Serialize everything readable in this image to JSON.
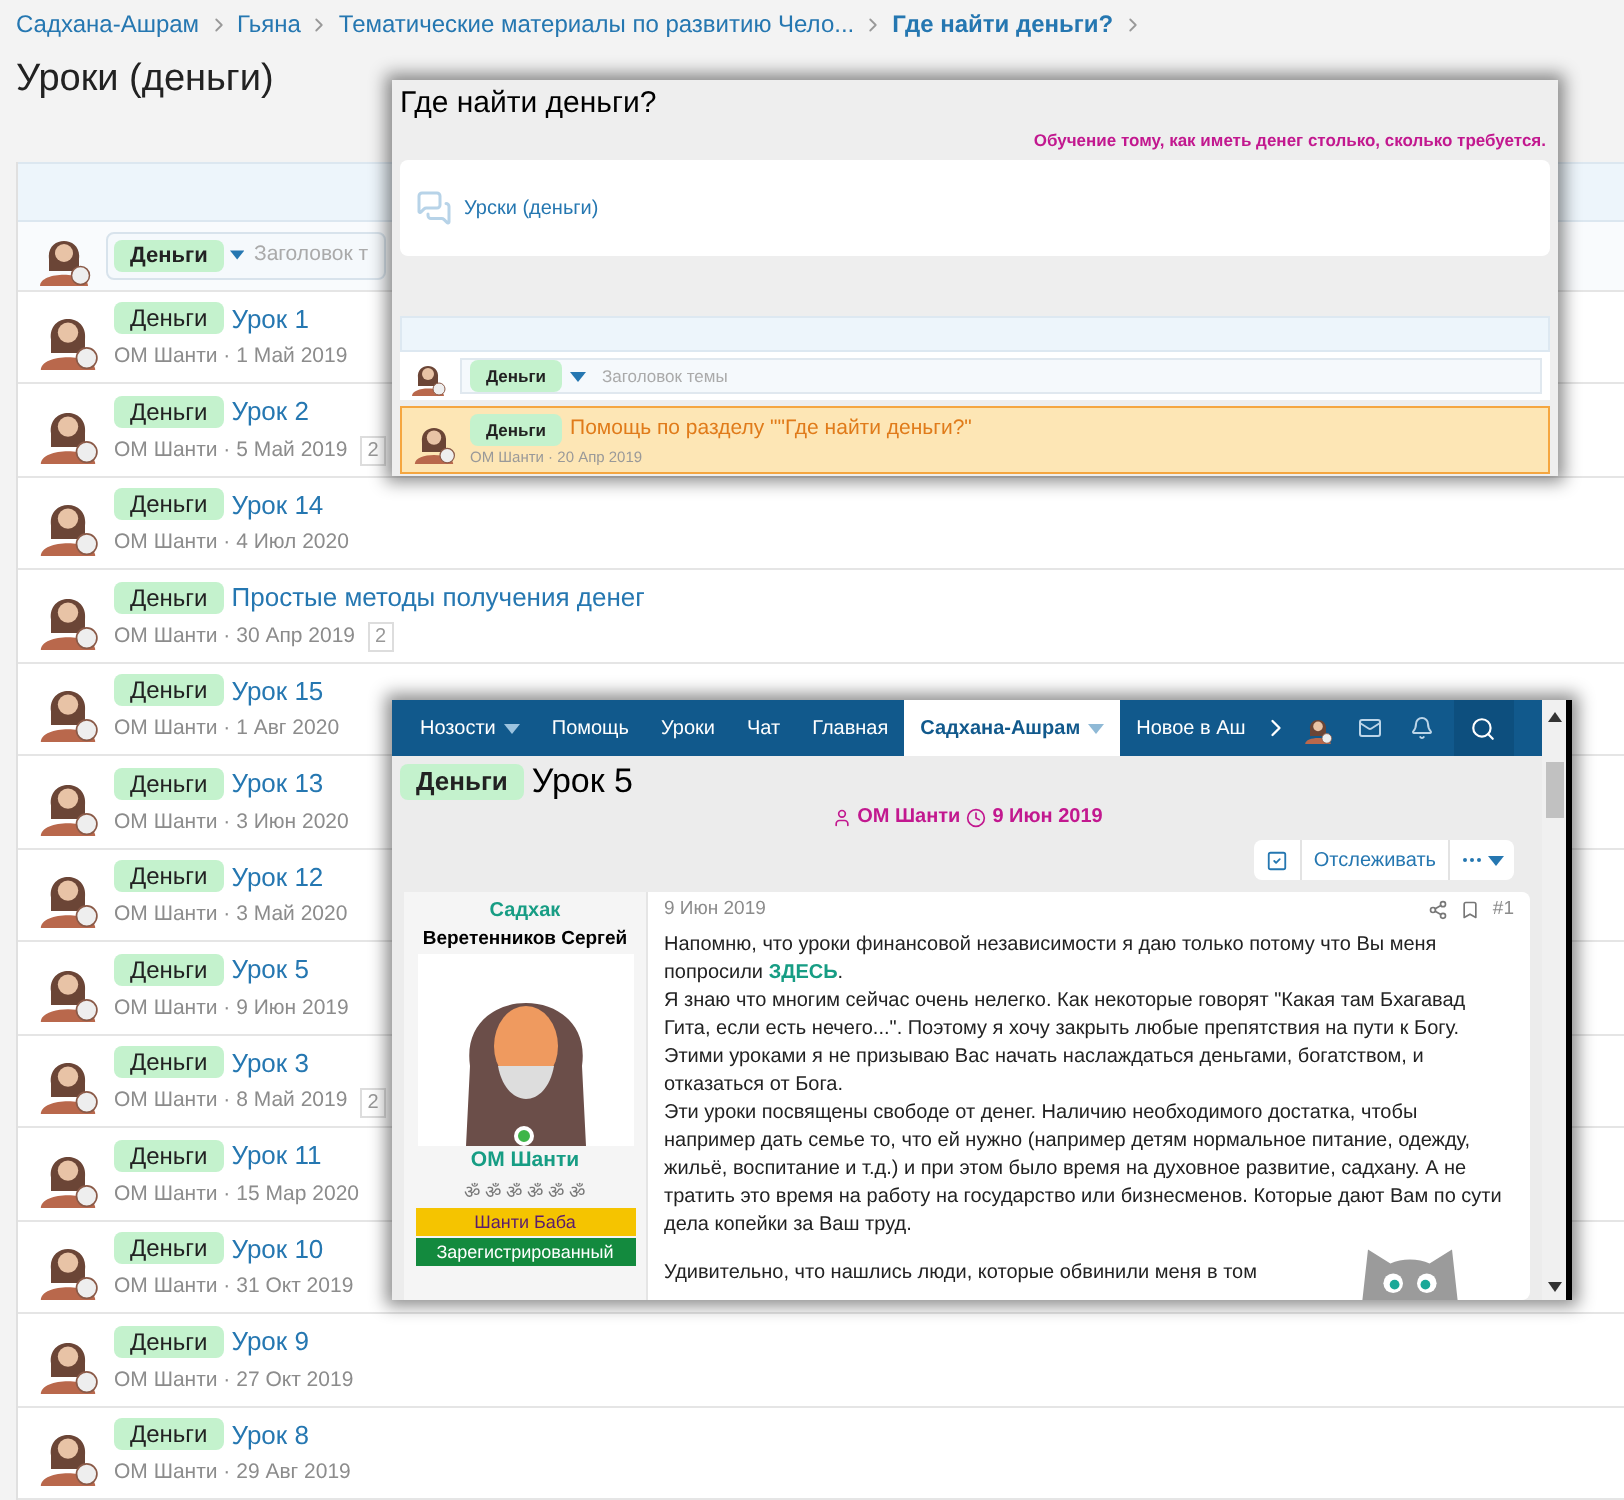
{
  "breadcrumbs": [
    {
      "label": "Садхана-Ашрам",
      "current": false
    },
    {
      "label": "Гьяна",
      "current": false
    },
    {
      "label": "Тематические материалы по развитию Чело...",
      "current": false
    },
    {
      "label": "Где найти деньги?",
      "current": true
    }
  ],
  "page_title": "Уроки (деньги)",
  "new_thread": {
    "prefix": "Деньги",
    "placeholder": "Заголовок т"
  },
  "threads": [
    {
      "prefix": "Деньги",
      "title": "Урок 1",
      "meta": "ОМ Шанти · 1 Май 2019"
    },
    {
      "prefix": "Деньги",
      "title": "Урок 2",
      "meta": "ОМ Шанти · 5 Май 2019",
      "replies": "2"
    },
    {
      "prefix": "Деньги",
      "title": "Урок 14",
      "meta": "ОМ Шанти · 4 Июл 2020"
    },
    {
      "prefix": "Деньги",
      "title": "Простые методы получения денег",
      "meta": "ОМ Шанти · 30 Апр 2019",
      "replies": "2"
    },
    {
      "prefix": "Деньги",
      "title": "Урок 15",
      "meta": "ОМ Шанти · 1 Авг 2020"
    },
    {
      "prefix": "Деньги",
      "title": "Урок 13",
      "meta": "ОМ Шанти · 3 Июн 2020"
    },
    {
      "prefix": "Деньги",
      "title": "Урок 12",
      "meta": "ОМ Шанти · 3 Май 2020"
    },
    {
      "prefix": "Деньги",
      "title": "Урок 5",
      "meta": "ОМ Шанти · 9 Июн 2019"
    },
    {
      "prefix": "Деньги",
      "title": "Урок 3",
      "meta": "ОМ Шанти · 8 Май 2019",
      "replies": "2"
    },
    {
      "prefix": "Деньги",
      "title": "Урок 11",
      "meta": "ОМ Шанти · 15 Мар 2020"
    },
    {
      "prefix": "Деньги",
      "title": "Урок 10",
      "meta": "ОМ Шанти · 31 Окт 2019"
    },
    {
      "prefix": "Деньги",
      "title": "Урок 9",
      "meta": "ОМ Шанти · 27 Окт 2019"
    },
    {
      "prefix": "Деньги",
      "title": "Урок 8",
      "meta": "ОМ Шанти · 29 Авг 2019"
    }
  ],
  "forum_popup": {
    "title": "Где найти деньги?",
    "description": "Обучение тому, как иметь денег столько, сколько требуется.",
    "subforum": "Урски (деньги)",
    "new_thread": {
      "prefix": "Деньги",
      "placeholder": "Заголовок темы"
    },
    "sticky_thread": {
      "prefix": "Деньги",
      "title": "Помощь по разделу \"\"Где найти деньги?\"",
      "meta": "ОМ Шанти · 20 Апр 2019"
    }
  },
  "thread_popup": {
    "nav": [
      {
        "label": "Нозости",
        "selected": false,
        "has_menu": true
      },
      {
        "label": "Помощь",
        "selected": false,
        "has_menu": false
      },
      {
        "label": "Уроки",
        "selected": false,
        "has_menu": false
      },
      {
        "label": "Чат",
        "selected": false,
        "has_menu": false
      },
      {
        "label": "Главная",
        "selected": false,
        "has_menu": false
      },
      {
        "label": "Садхана-Ашрам",
        "selected": true,
        "has_menu": true
      },
      {
        "label": "Новое в Аш",
        "selected": false,
        "has_menu": false
      }
    ],
    "prefix": "Деньги",
    "title": "Урок 5",
    "author": "ОМ Шанти",
    "date": "9 Июн 2019",
    "watch_button": "Отслеживать",
    "user": {
      "title": "Садхак",
      "real_name": "Веретенников Сергей",
      "name": "ОМ Шанти",
      "rank_symbols": "ॐ ॐ ॐ ॐ ॐ ॐ",
      "badges": [
        {
          "label": "Шанти Баба",
          "color": "#f5c400"
        },
        {
          "label": "Зарегистрированный",
          "color": "#138a3e"
        }
      ]
    },
    "post_date": "9 Июн 2019",
    "post_number": "#1",
    "paragraphs": [
      {
        "text": "Напомню, что уроки финансовой независимости я даю только потому что Вы меня попросили",
        "link": "ЗДЕСЬ",
        "after": "."
      },
      {
        "text": "Я знаю что многим сейчас очень нелегко. Как некоторые говорят \"Какая там Бхагавад Гита, если есть нечего...\". Поэтому я хочу закрыть любые препятствия на пути к Богу."
      },
      {
        "text": "Этими уроками я не призываю Вас начать наслаждаться деньгами, богатством, и отказаться от Бога."
      },
      {
        "text": "Эти уроки посвящены свободе от денег. Наличию необходимого достатка, чтобы например дать семье то, что ей нужно (например детям нормальное питание, одежду, жильё, воспитание и т.д.) и при этом было время на духовное развитие, садхану. А не тратить это время на работу на государство или бизнесменов. Которые дают Вам по сути дела копейки за Ваш труд."
      },
      {
        "text": "Удивительно, что нашлись люди, которые обвинили меня в том",
        "gap": true
      }
    ]
  }
}
